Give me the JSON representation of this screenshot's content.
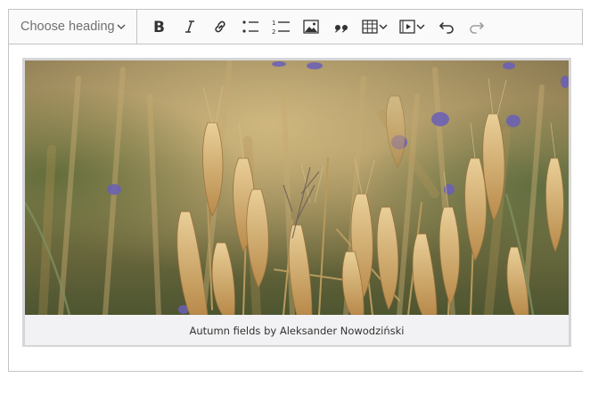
{
  "toolbar": {
    "heading_dropdown_label": "Choose heading",
    "buttons": [
      {
        "name": "bold-button",
        "icon": "bold-icon"
      },
      {
        "name": "italic-button",
        "icon": "italic-icon"
      },
      {
        "name": "link-button",
        "icon": "link-icon"
      },
      {
        "name": "bulleted-list-button",
        "icon": "bulleted-list-icon"
      },
      {
        "name": "numbered-list-button",
        "icon": "numbered-list-icon"
      },
      {
        "name": "insert-image-button",
        "icon": "image-icon"
      },
      {
        "name": "block-quote-button",
        "icon": "quote-icon"
      },
      {
        "name": "insert-table-button",
        "icon": "table-icon"
      },
      {
        "name": "insert-media-button",
        "icon": "media-icon"
      },
      {
        "name": "undo-button",
        "icon": "undo-icon"
      },
      {
        "name": "redo-button",
        "icon": "redo-icon"
      }
    ]
  },
  "content": {
    "image": {
      "subject": "wheat-field-photo",
      "caption": "Autumn fields by Aleksander Nowodziński"
    }
  },
  "colors": {
    "toolbar_bg": "#fafafa",
    "border": "#c4c4c4",
    "icon": "#333333",
    "icon_disabled": "#9e9e9e",
    "figure_bg": "#f2f1f3"
  }
}
